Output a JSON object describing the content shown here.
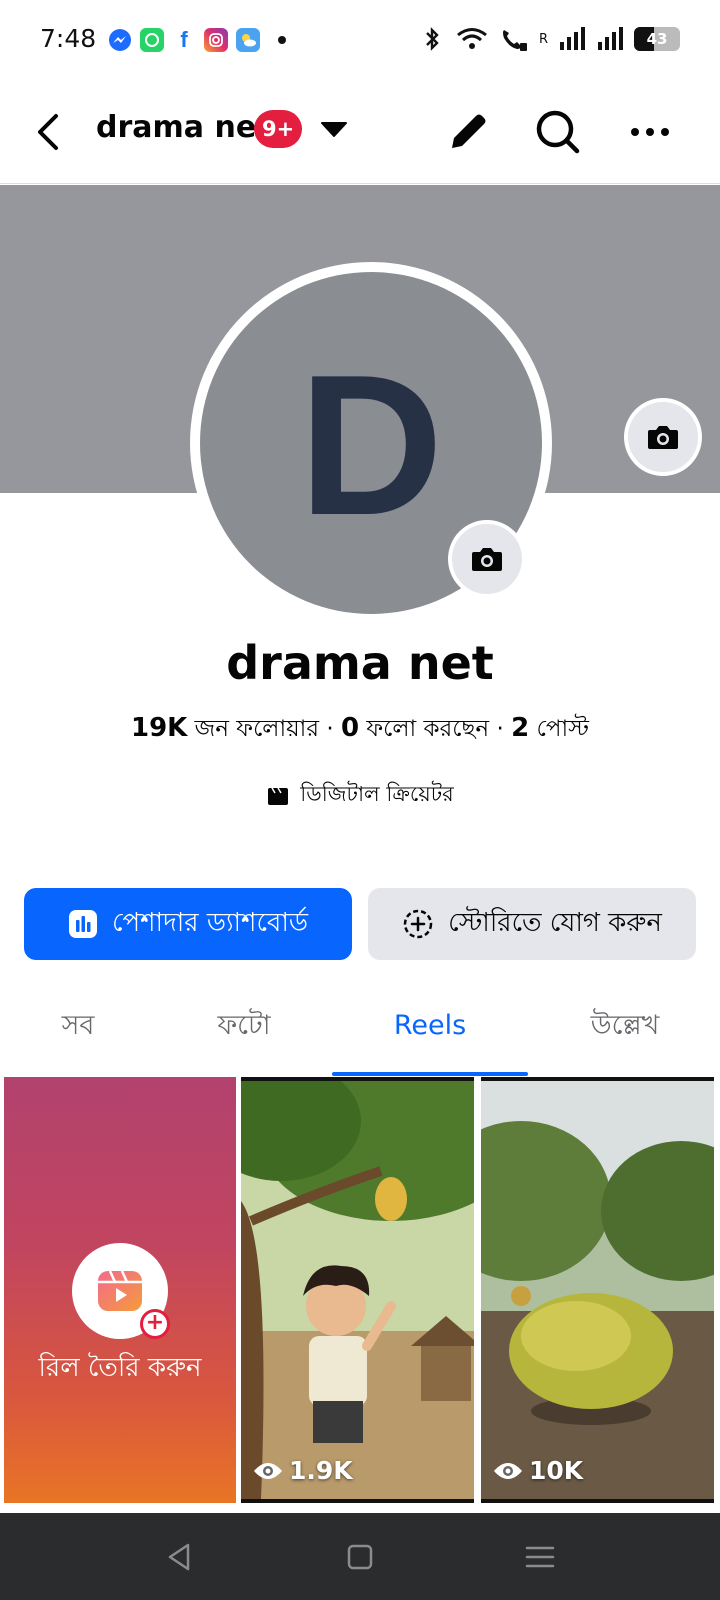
{
  "status_bar": {
    "time": "7:48",
    "battery": "43",
    "battery_level": 0.43,
    "roaming": "R"
  },
  "header": {
    "title": "drama net",
    "badge": "9+"
  },
  "profile": {
    "avatar_letter": "D",
    "name": "drama net",
    "followers_count": "19K",
    "followers_label": "জন ফলোয়ার",
    "following_count": "0",
    "following_label": "ফলো করছেন",
    "posts_count": "2",
    "posts_label": "পোস্ট",
    "separator": "·",
    "category": "ডিজিটাল ক্রিয়েটর"
  },
  "actions": {
    "primary_label": "পেশাদার ড্যাশবোর্ড",
    "secondary_label": "স্টোরিতে যোগ করুন"
  },
  "tabs": [
    {
      "label": "সব",
      "active": false
    },
    {
      "label": "ফটো",
      "active": false
    },
    {
      "label": "Reels",
      "active": true
    },
    {
      "label": "উল্লেখ",
      "active": false
    }
  ],
  "reels": {
    "create_label": "রিল তৈরি করুন",
    "items": [
      {
        "views": "1.9K",
        "thumbnail": "boy-under-mango-tree"
      },
      {
        "views": "10K",
        "thumbnail": "mango-on-ground"
      }
    ]
  },
  "colors": {
    "accent": "#0866ff",
    "badge": "#e41e3f",
    "cover": "#95979c",
    "secondary_button": "#e4e6eb"
  }
}
